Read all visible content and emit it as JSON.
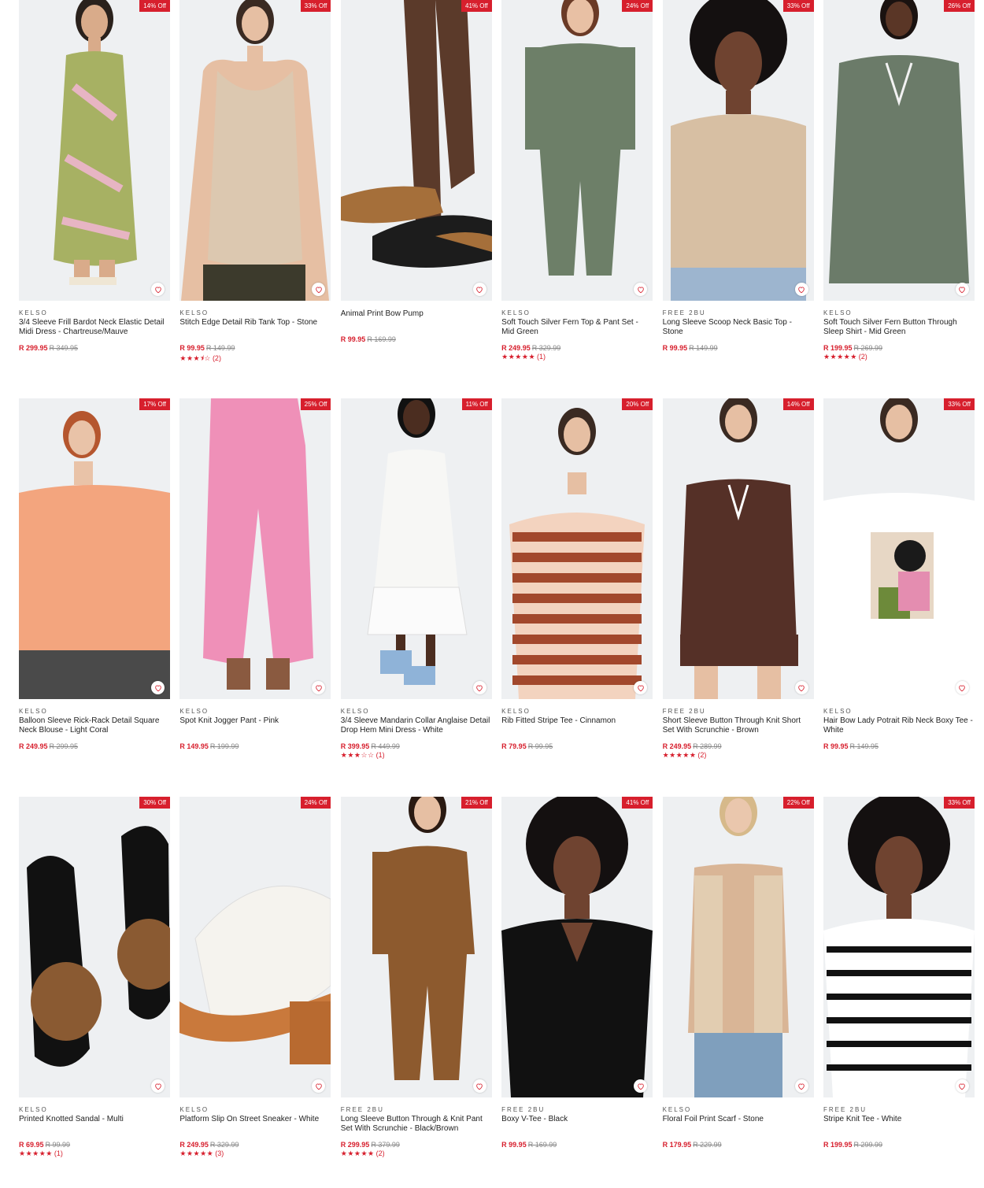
{
  "products": [
    {
      "badge": "14% Off",
      "brand": "KELSO",
      "name": "3/4 Sleeve Frill Bardot Neck Elastic Detail Midi Dress - Chartreuse/Mauve",
      "price": "R 299.95",
      "was": "R 349.95",
      "stars": "",
      "count": "",
      "bg": "#eef0f2",
      "garment": "dress",
      "color": "#a7b163",
      "skin": "#d9ab8a"
    },
    {
      "badge": "33% Off",
      "brand": "KELSO",
      "name": "Stitch Edge Detail Rib Tank Top - Stone",
      "price": "R 99.95",
      "was": "R 149.99",
      "stars": "★★★⯨☆",
      "count": "(2)",
      "bg": "#eef0f2",
      "garment": "tank",
      "color": "#dcc8b0",
      "skin": "#e6bfa3"
    },
    {
      "badge": "41% Off",
      "brand": "",
      "name": "Animal Print Bow Pump",
      "price": "R 99.95",
      "was": "R 169.99",
      "stars": "",
      "count": "",
      "bg": "#eef0f2",
      "garment": "shoes",
      "color": "#a56f3a",
      "skin": "#5b3a2a"
    },
    {
      "badge": "24% Off",
      "brand": "KELSO",
      "name": "Soft Touch Silver Fern Top & Pant Set - Mid Green",
      "price": "R 249.95",
      "was": "R 329.99",
      "stars": "★★★★★",
      "count": "(1)",
      "bg": "#eef0f2",
      "garment": "set",
      "color": "#6d7f68",
      "skin": "#e8c0a4"
    },
    {
      "badge": "33% Off",
      "brand": "FREE 2BU",
      "name": "Long Sleeve Scoop Neck Basic Top - Stone",
      "price": "R 99.95",
      "was": "R 149.99",
      "stars": "",
      "count": "",
      "bg": "#eef0f2",
      "garment": "longtop",
      "color": "#d7bfa3",
      "skin": "#6f4330"
    },
    {
      "badge": "26% Off",
      "brand": "KELSO",
      "name": "Soft Touch Silver Fern Button Through Sleep Shirt - Mid Green",
      "price": "R 199.95",
      "was": "R 269.99",
      "stars": "★★★★★",
      "count": "(2)",
      "bg": "#eef0f2",
      "garment": "shirt",
      "color": "#6b7b69",
      "skin": "#5a3626"
    },
    {
      "badge": "17% Off",
      "brand": "KELSO",
      "name": "Balloon Sleeve Rick-Rack Detail Square Neck Blouse - Light Coral",
      "price": "R 249.95",
      "was": "R 299.95",
      "stars": "",
      "count": "",
      "bg": "#eef0f2",
      "garment": "blouse",
      "color": "#f3a57e",
      "skin": "#e9c3a8"
    },
    {
      "badge": "25% Off",
      "brand": "KELSO",
      "name": "Spot Knit Jogger Pant - Pink",
      "price": "R 149.95",
      "was": "R 199.99",
      "stars": "",
      "count": "",
      "bg": "#eef0f2",
      "garment": "pants",
      "color": "#ef90b8",
      "skin": "#8a5a40"
    },
    {
      "badge": "11% Off",
      "brand": "KELSO",
      "name": "3/4 Sleeve Mandarin Collar Anglaise Detail Drop Hem Mini Dress - White",
      "price": "R 399.95",
      "was": "R 449.99",
      "stars": "★★★☆☆",
      "count": "(1)",
      "bg": "#eef0f2",
      "garment": "whitedress",
      "color": "#f7f7f5",
      "skin": "#4b2d20"
    },
    {
      "badge": "20% Off",
      "brand": "KELSO",
      "name": "Rib Fitted Stripe Tee - Cinnamon",
      "price": "R 79.95",
      "was": "R 99.95",
      "stars": "",
      "count": "",
      "bg": "#eef0f2",
      "garment": "stripetee",
      "color": "#a2482c",
      "skin": "#e6bfa3"
    },
    {
      "badge": "14% Off",
      "brand": "FREE 2BU",
      "name": "Short Sleeve Button Through Knit Short Set With Scrunchie - Brown",
      "price": "R 249.95",
      "was": "R 289.99",
      "stars": "★★★★★",
      "count": "(2)",
      "bg": "#eef0f2",
      "garment": "shortset",
      "color": "#553027",
      "skin": "#e6bfa3"
    },
    {
      "badge": "33% Off",
      "brand": "KELSO",
      "name": "Hair Bow Lady Potrait Rib Neck Boxy Tee - White",
      "price": "R 99.95",
      "was": "R 149.95",
      "stars": "",
      "count": "",
      "bg": "#eef0f2",
      "garment": "printtee",
      "color": "#ffffff",
      "skin": "#e6bfa3"
    },
    {
      "badge": "30% Off",
      "brand": "KELSO",
      "name": "Printed Knotted Sandal - Multi",
      "price": "R 69.95",
      "was": "R 99.99",
      "stars": "★★★★★",
      "count": "(1)",
      "bg": "#eef0f2",
      "garment": "sandals",
      "color": "#8a5a32",
      "skin": "#e6bfa3"
    },
    {
      "badge": "24% Off",
      "brand": "KELSO",
      "name": "Platform Slip On Street Sneaker - White",
      "price": "R 249.95",
      "was": "R 329.99",
      "stars": "★★★★★",
      "count": "(3)",
      "bg": "#eef0f2",
      "garment": "sneaker",
      "color": "#f5f3ee",
      "skin": "#e6bfa3"
    },
    {
      "badge": "21% Off",
      "brand": "FREE 2BU",
      "name": "Long Sleeve Button Through & Knit Pant Set With Scrunchie - Black/Brown",
      "price": "R 299.95",
      "was": "R 379.99",
      "stars": "★★★★★",
      "count": "(2)",
      "bg": "#eef0f2",
      "garment": "leopardset",
      "color": "#8d5a2e",
      "skin": "#e6bfa3"
    },
    {
      "badge": "41% Off",
      "brand": "FREE 2BU",
      "name": "Boxy V-Tee - Black",
      "price": "R 99.95",
      "was": "R 169.99",
      "stars": "",
      "count": "",
      "bg": "#eef0f2",
      "garment": "blacktee",
      "color": "#111111",
      "skin": "#6f4330"
    },
    {
      "badge": "22% Off",
      "brand": "KELSO",
      "name": "Floral Foil Print Scarf - Stone",
      "price": "R 179.95",
      "was": "R 229.99",
      "stars": "",
      "count": "",
      "bg": "#eef0f2",
      "garment": "scarf",
      "color": "#e2cdb1",
      "skin": "#eac7ad"
    },
    {
      "badge": "33% Off",
      "brand": "FREE 2BU",
      "name": "Stripe Knit Tee - White",
      "price": "R 199.95",
      "was": "R 299.99",
      "stars": "",
      "count": "",
      "bg": "#eef0f2",
      "garment": "knittee",
      "color": "#ffffff",
      "skin": "#6f4330"
    }
  ]
}
